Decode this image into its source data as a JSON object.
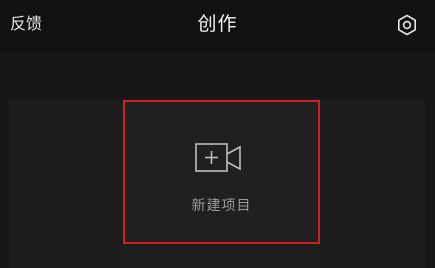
{
  "header": {
    "feedback_label": "反馈",
    "title": "创作",
    "settings_icon": "gear-icon"
  },
  "main": {
    "new_project": {
      "label": "新建项目",
      "icon": "video-add-icon",
      "highlight_color": "#d21f1f"
    }
  },
  "colors": {
    "background": "#141414",
    "text": "#f2f2f2",
    "muted_text": "#9a9a9a"
  }
}
